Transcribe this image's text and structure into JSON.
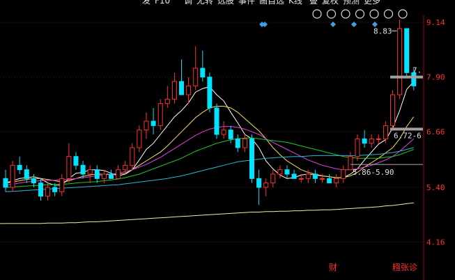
{
  "toolbar": {
    "items": [
      "发",
      "F10",
      "调",
      "尤转",
      "选股",
      "事件",
      "画自选",
      "K线",
      "叠",
      "复权",
      "预测",
      "更多"
    ],
    "icons": [
      "settings-icon",
      "pen-icon",
      "eye-icon",
      "store-icon",
      "hand-icon",
      "zoom-in-icon",
      "zoom-out-icon"
    ]
  },
  "chart_data": {
    "type": "candlestick",
    "y_ticks": [
      "9.14",
      "7.90",
      "6.66",
      "5.40",
      "4.16"
    ],
    "ylim": [
      3.3,
      9.3
    ],
    "grid": true,
    "colors": {
      "up": "#ff3232",
      "down": "#00e4ff",
      "ma5": "#ffffff",
      "ma10": "#f6e05e",
      "ma20": "#e040e0",
      "ma30": "#22cc22",
      "ma60": "#2ab8d8",
      "ma250": "#f0f0a0"
    },
    "candles": [
      [
        5.6,
        5.8,
        5.3,
        5.4
      ],
      [
        5.4,
        6.0,
        5.3,
        5.9
      ],
      [
        5.9,
        6.1,
        5.7,
        5.8
      ],
      [
        5.8,
        5.9,
        5.5,
        5.6
      ],
      [
        5.6,
        5.7,
        5.4,
        5.5
      ],
      [
        5.5,
        5.6,
        5.1,
        5.2
      ],
      [
        5.2,
        5.5,
        5.1,
        5.4
      ],
      [
        5.4,
        5.5,
        5.2,
        5.3
      ],
      [
        5.3,
        5.7,
        5.2,
        5.6
      ],
      [
        5.6,
        6.4,
        5.5,
        6.1
      ],
      [
        6.1,
        6.2,
        5.8,
        5.9
      ],
      [
        5.9,
        6.0,
        5.6,
        5.7
      ],
      [
        5.7,
        5.9,
        5.5,
        5.8
      ],
      [
        5.8,
        5.9,
        5.5,
        5.6
      ],
      [
        5.6,
        5.8,
        5.5,
        5.7
      ],
      [
        5.7,
        5.8,
        5.6,
        5.6
      ],
      [
        5.6,
        5.9,
        5.6,
        5.8
      ],
      [
        5.8,
        6.0,
        5.7,
        5.9
      ],
      [
        5.9,
        6.4,
        5.8,
        6.3
      ],
      [
        6.3,
        6.8,
        6.2,
        6.7
      ],
      [
        6.7,
        7.1,
        6.5,
        6.9
      ],
      [
        6.9,
        7.2,
        6.6,
        6.8
      ],
      [
        6.8,
        7.4,
        6.7,
        7.3
      ],
      [
        7.3,
        7.7,
        7.2,
        7.4
      ],
      [
        7.4,
        8.0,
        7.3,
        7.8
      ],
      [
        7.8,
        8.3,
        7.6,
        7.5
      ],
      [
        7.5,
        7.9,
        7.3,
        7.7
      ],
      [
        7.7,
        8.6,
        7.6,
        8.1
      ],
      [
        8.1,
        8.5,
        7.8,
        7.9
      ],
      [
        7.9,
        8.0,
        7.1,
        7.2
      ],
      [
        7.2,
        7.3,
        6.5,
        6.6
      ],
      [
        6.6,
        6.9,
        6.5,
        6.7
      ],
      [
        6.7,
        6.8,
        6.4,
        6.5
      ],
      [
        6.5,
        6.6,
        6.2,
        6.3
      ],
      [
        6.3,
        6.6,
        6.2,
        6.5
      ],
      [
        6.5,
        6.6,
        5.5,
        5.6
      ],
      [
        5.6,
        5.8,
        5.0,
        5.4
      ],
      [
        5.4,
        5.6,
        5.2,
        5.5
      ],
      [
        5.5,
        5.8,
        5.4,
        5.7
      ],
      [
        5.7,
        5.9,
        5.6,
        5.8
      ],
      [
        5.8,
        5.9,
        5.6,
        5.7
      ],
      [
        5.7,
        5.8,
        5.6,
        5.6
      ],
      [
        5.6,
        5.7,
        5.5,
        5.6
      ],
      [
        5.6,
        5.8,
        5.5,
        5.7
      ],
      [
        5.7,
        5.8,
        5.5,
        5.6
      ],
      [
        5.6,
        5.7,
        5.5,
        5.6
      ],
      [
        5.6,
        5.7,
        5.5,
        5.5
      ],
      [
        5.5,
        5.7,
        5.4,
        5.6
      ],
      [
        5.6,
        5.9,
        5.5,
        5.8
      ],
      [
        5.8,
        6.2,
        5.8,
        6.1
      ],
      [
        6.1,
        6.6,
        6.0,
        6.5
      ],
      [
        6.5,
        6.7,
        6.3,
        6.4
      ],
      [
        6.4,
        6.6,
        6.3,
        6.5
      ],
      [
        6.5,
        6.6,
        6.4,
        6.5
      ],
      [
        6.5,
        6.9,
        6.4,
        6.8
      ],
      [
        6.8,
        7.6,
        6.7,
        7.5
      ],
      [
        7.5,
        9.2,
        7.4,
        9.0
      ],
      [
        9.0,
        9.0,
        7.9,
        8.0
      ],
      [
        8.0,
        8.1,
        7.6,
        7.7
      ]
    ],
    "moving_averages": [
      {
        "key": "ma5",
        "values": [
          5.5,
          5.55,
          5.6,
          5.62,
          5.64,
          5.6,
          5.5,
          5.45,
          5.45,
          5.6,
          5.72,
          5.74,
          5.8,
          5.8,
          5.78,
          5.72,
          5.66,
          5.7,
          5.8,
          6.02,
          6.26,
          6.4,
          6.6,
          6.8,
          7.0,
          7.14,
          7.32,
          7.56,
          7.64,
          7.68,
          7.5,
          7.36,
          7.1,
          6.86,
          6.6,
          6.5,
          6.3,
          6.0,
          5.82,
          5.68,
          5.6,
          5.62,
          5.68,
          5.7,
          5.68,
          5.66,
          5.64,
          5.62,
          5.62,
          5.7,
          5.82,
          6.02,
          6.2,
          6.38,
          6.48,
          6.74,
          7.14,
          7.62,
          7.8
        ]
      },
      {
        "key": "ma10",
        "values": [
          5.5,
          5.52,
          5.55,
          5.58,
          5.6,
          5.6,
          5.58,
          5.55,
          5.52,
          5.55,
          5.6,
          5.65,
          5.68,
          5.7,
          5.7,
          5.7,
          5.7,
          5.72,
          5.8,
          5.9,
          6.0,
          6.1,
          6.2,
          6.34,
          6.5,
          6.66,
          6.82,
          6.98,
          7.1,
          7.2,
          7.24,
          7.24,
          7.2,
          7.1,
          6.96,
          6.82,
          6.68,
          6.5,
          6.3,
          6.14,
          6.0,
          5.9,
          5.8,
          5.74,
          5.7,
          5.66,
          5.64,
          5.62,
          5.62,
          5.66,
          5.74,
          5.86,
          5.96,
          6.06,
          6.18,
          6.3,
          6.5,
          6.78,
          7.0
        ]
      },
      {
        "key": "ma20",
        "values": [
          5.45,
          5.47,
          5.5,
          5.52,
          5.54,
          5.55,
          5.56,
          5.56,
          5.57,
          5.58,
          5.6,
          5.62,
          5.64,
          5.66,
          5.68,
          5.7,
          5.72,
          5.76,
          5.8,
          5.86,
          5.92,
          6.0,
          6.08,
          6.18,
          6.28,
          6.38,
          6.48,
          6.58,
          6.66,
          6.72,
          6.76,
          6.78,
          6.78,
          6.76,
          6.72,
          6.66,
          6.6,
          6.5,
          6.42,
          6.34,
          6.26,
          6.18,
          6.1,
          6.02,
          5.96,
          5.9,
          5.86,
          5.82,
          5.8,
          5.8,
          5.82,
          5.86,
          5.9,
          5.96,
          6.02,
          6.1,
          6.22,
          6.36,
          6.5
        ]
      },
      {
        "key": "ma30",
        "values": [
          5.4,
          5.41,
          5.42,
          5.43,
          5.44,
          5.45,
          5.46,
          5.46,
          5.47,
          5.48,
          5.5,
          5.51,
          5.52,
          5.53,
          5.55,
          5.57,
          5.59,
          5.62,
          5.66,
          5.7,
          5.76,
          5.82,
          5.88,
          5.94,
          6.0,
          6.06,
          6.14,
          6.22,
          6.28,
          6.34,
          6.4,
          6.44,
          6.48,
          6.5,
          6.52,
          6.52,
          6.5,
          6.48,
          6.46,
          6.44,
          6.42,
          6.38,
          6.34,
          6.3,
          6.26,
          6.22,
          6.18,
          6.14,
          6.1,
          6.08,
          6.06,
          6.06,
          6.06,
          6.06,
          6.08,
          6.1,
          6.14,
          6.2,
          6.26
        ]
      },
      {
        "key": "ma60",
        "values": [
          5.3,
          5.31,
          5.32,
          5.33,
          5.34,
          5.35,
          5.36,
          5.37,
          5.38,
          5.39,
          5.4,
          5.41,
          5.42,
          5.43,
          5.44,
          5.45,
          5.46,
          5.48,
          5.5,
          5.52,
          5.54,
          5.56,
          5.58,
          5.6,
          5.63,
          5.66,
          5.7,
          5.74,
          5.78,
          5.82,
          5.86,
          5.9,
          5.94,
          5.98,
          6.0,
          6.02,
          6.04,
          6.06,
          6.07,
          6.08,
          6.09,
          6.1,
          6.1,
          6.11,
          6.12,
          6.12,
          6.12,
          6.12,
          6.12,
          6.12,
          6.12,
          6.13,
          6.14,
          6.15,
          6.17,
          6.19,
          6.22,
          6.26,
          6.3
        ]
      },
      {
        "key": "ma250",
        "values": [
          4.58,
          4.58,
          4.58,
          4.58,
          4.58,
          4.58,
          4.59,
          4.59,
          4.59,
          4.6,
          4.6,
          4.61,
          4.62,
          4.62,
          4.63,
          4.64,
          4.65,
          4.66,
          4.67,
          4.68,
          4.69,
          4.7,
          4.71,
          4.72,
          4.73,
          4.74,
          4.75,
          4.76,
          4.77,
          4.78,
          4.79,
          4.8,
          4.81,
          4.82,
          4.83,
          4.84,
          4.84,
          4.85,
          4.85,
          4.86,
          4.86,
          4.87,
          4.87,
          4.88,
          4.88,
          4.89,
          4.89,
          4.9,
          4.91,
          4.92,
          4.93,
          4.94,
          4.95,
          4.96,
          4.98,
          4.99,
          5.01,
          5.03,
          5.05
        ]
      }
    ],
    "annotations": {
      "high_label": "8.83",
      "right_tags": [
        {
          "text": "7.",
          "y": 7.9
        },
        {
          "text": "6.72-6",
          "y": 6.7
        }
      ],
      "range_label": "5.86-5.90",
      "horizontal_lines": [
        {
          "y": 7.9,
          "color": "#a0a0a0"
        },
        {
          "y": 6.72,
          "color": "#a0a0a0"
        },
        {
          "y": 5.92,
          "color": "#b0b0b0"
        }
      ]
    },
    "bottom_labels": {
      "left": "财",
      "right": "糨张诊"
    }
  }
}
